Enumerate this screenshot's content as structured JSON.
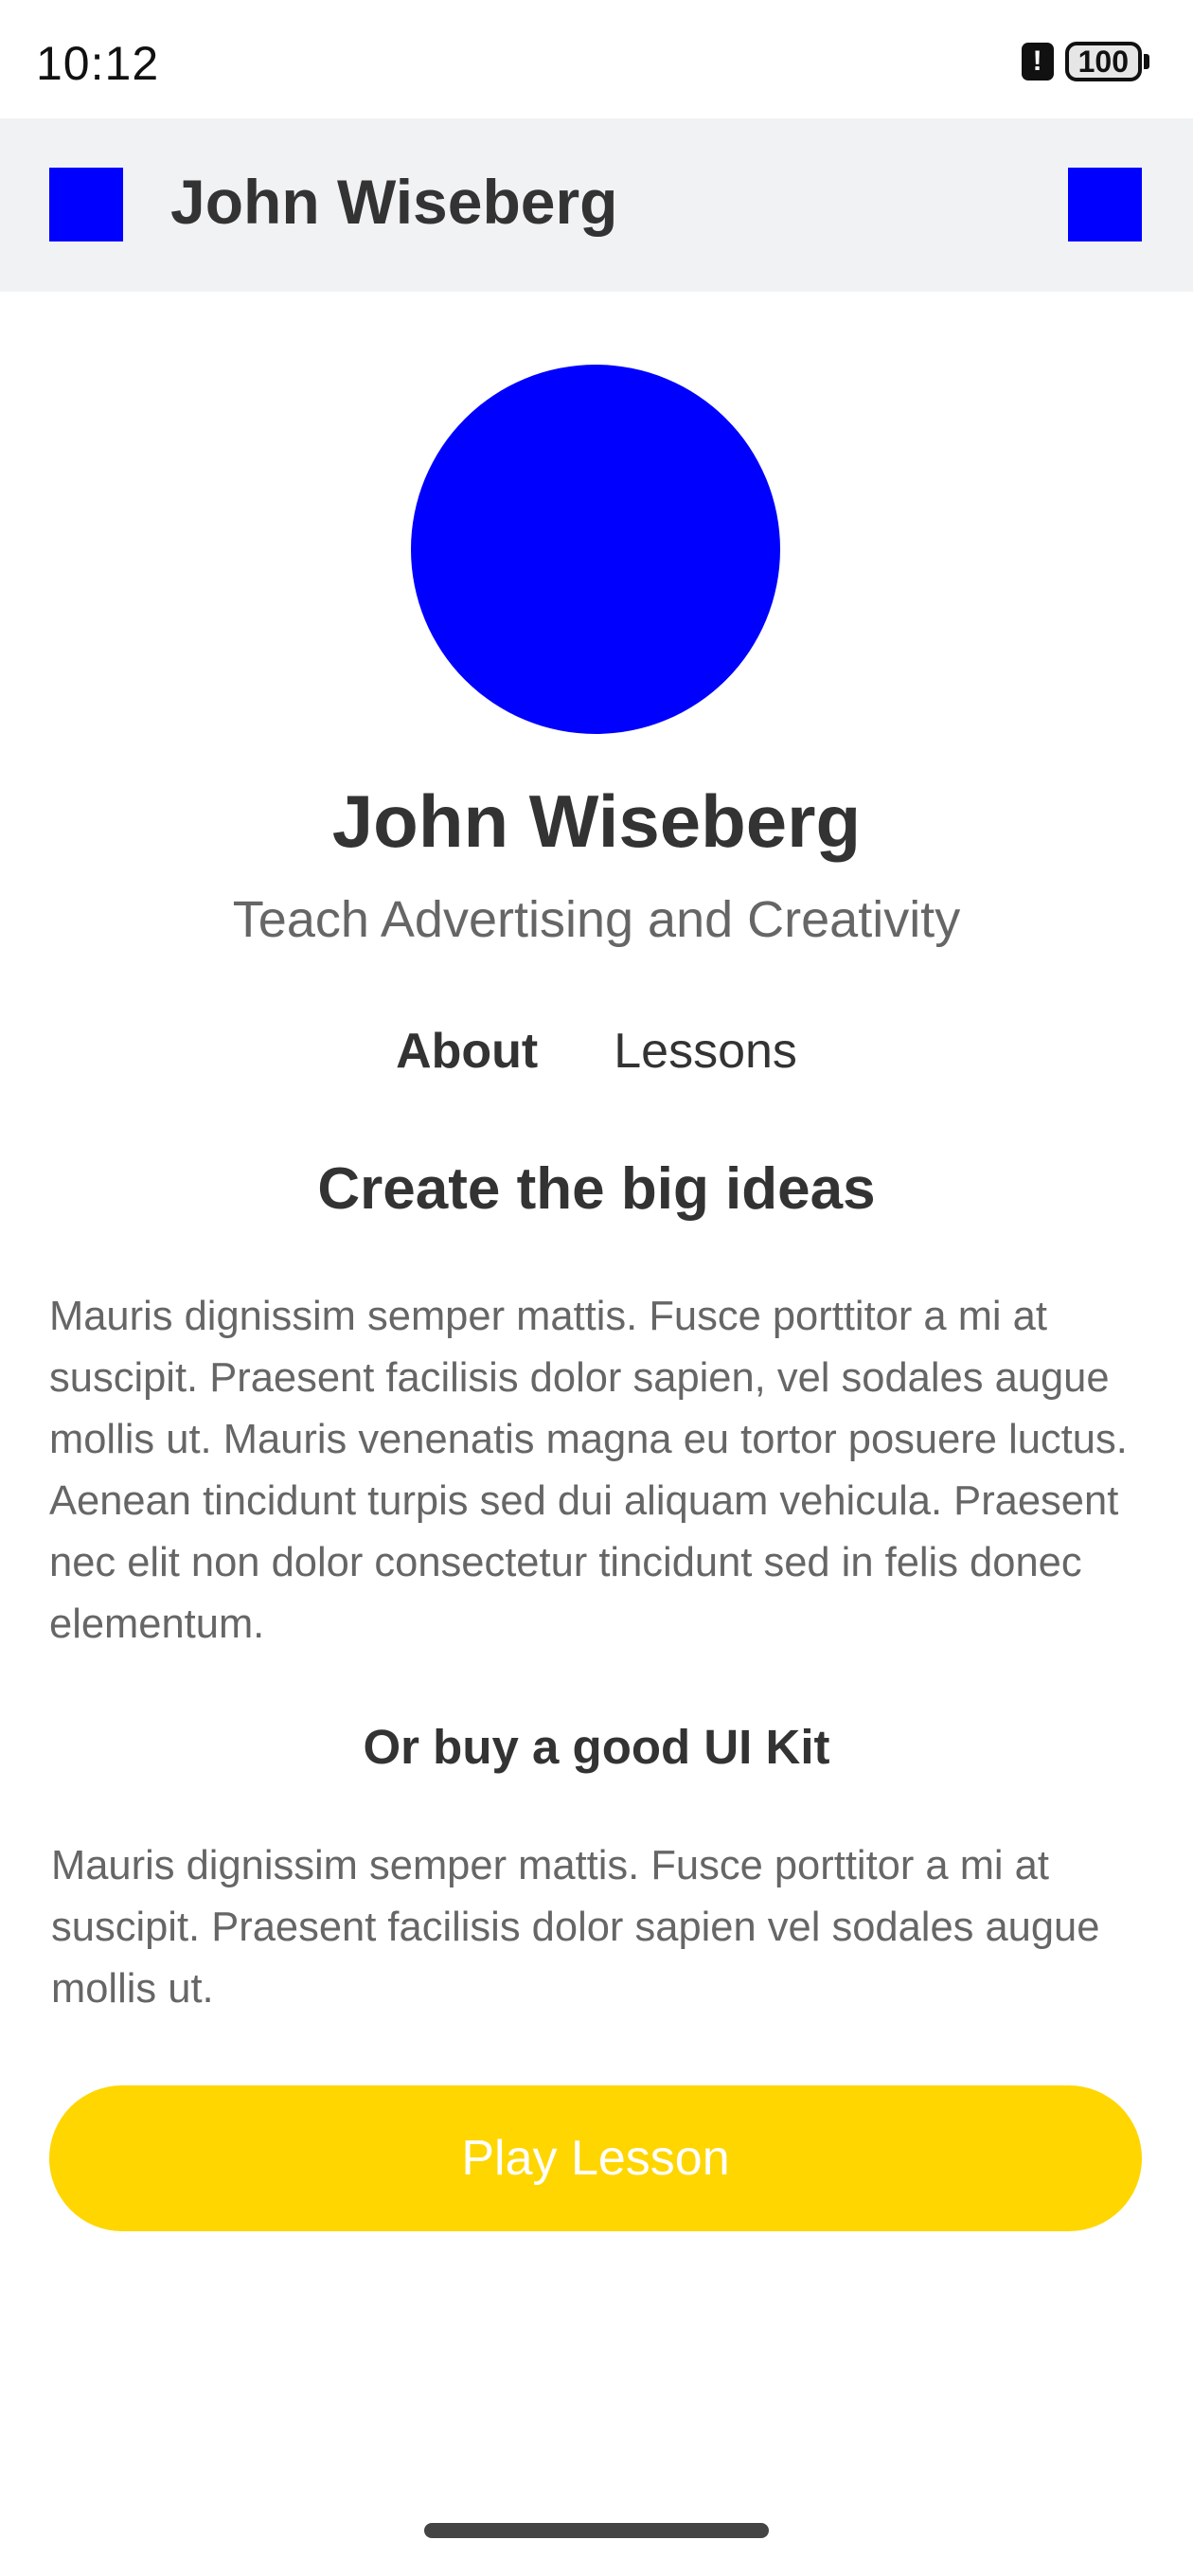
{
  "status_bar": {
    "time": "10:12",
    "alert_glyph": "!",
    "battery_level": "100"
  },
  "app_bar": {
    "title": "John Wiseberg",
    "left_icon": "menu-icon",
    "right_icon": "more-icon"
  },
  "profile": {
    "name": "John Wiseberg",
    "subtitle": "Teach Advertising and Creativity"
  },
  "tabs": [
    {
      "label": "About",
      "active": true
    },
    {
      "label": "Lessons",
      "active": false
    }
  ],
  "content": {
    "heading": "Create the big ideas",
    "paragraph1": "Mauris dignissim semper mattis. Fusce porttitor a mi at suscipit. Praesent facilisis dolor sapien, vel sodales augue mollis ut. Mauris venenatis magna eu tortor posuere luctus. Aenean tincidunt turpis sed dui aliquam vehicula. Praesent nec elit non dolor consectetur tincidunt sed in felis donec elementum.",
    "subheading": "Or buy a good UI Kit",
    "paragraph2": "Mauris dignissim semper mattis. Fusce porttitor a mi at suscipit. Praesent facilisis dolor sapien vel sodales augue mollis ut."
  },
  "actions": {
    "play_label": "Play Lesson"
  },
  "colors": {
    "accent_yellow": "#ffd600",
    "placeholder_blue": "#0000ff",
    "app_bar_bg": "#f1f2f4"
  }
}
